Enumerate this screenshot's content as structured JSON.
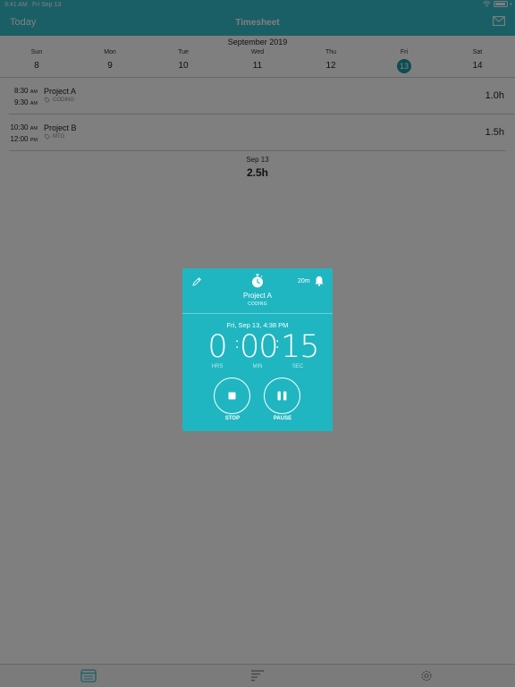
{
  "status_bar": {
    "time": "9:41 AM",
    "date": "Fri Sep 13"
  },
  "nav": {
    "today_label": "Today",
    "title": "Timesheet"
  },
  "calendar": {
    "month": "September 2019",
    "days": [
      {
        "name": "Sun",
        "num": "8"
      },
      {
        "name": "Mon",
        "num": "9"
      },
      {
        "name": "Tue",
        "num": "10"
      },
      {
        "name": "Wed",
        "num": "11"
      },
      {
        "name": "Thu",
        "num": "12"
      },
      {
        "name": "Fri",
        "num": "13"
      },
      {
        "name": "Sat",
        "num": "14"
      }
    ],
    "selected_day": "13"
  },
  "entries": [
    {
      "start_time": "8:30",
      "start_ampm": "AM",
      "end_time": "9:30",
      "end_ampm": "AM",
      "project": "Project A",
      "tag": "CODING",
      "hours": "1.0h"
    },
    {
      "start_time": "10:30",
      "start_ampm": "AM",
      "end_time": "12:00",
      "end_ampm": "PM",
      "project": "Project B",
      "tag": "MTG",
      "hours": "1.5h"
    }
  ],
  "summary": {
    "date": "Sep 13",
    "total": "2.5h"
  },
  "timer_card": {
    "reminder": "20m",
    "project": "Project A",
    "tag": "CODING",
    "datetime": "Fri, Sep 13, 4:38 PM",
    "hours": "0",
    "minutes": "00",
    "seconds": "15",
    "hours_unit": "HRS",
    "minutes_unit": "MIN",
    "seconds_unit": "SEC",
    "stop_label": "STOP",
    "pause_label": "PAUSE"
  },
  "colors": {
    "accent": "#35bfca",
    "card": "#1fb6c1",
    "selected_day": "#1a9aa3"
  },
  "tabbar": {
    "icons": [
      "timesheet-icon",
      "report-icon",
      "settings-icon"
    ]
  }
}
